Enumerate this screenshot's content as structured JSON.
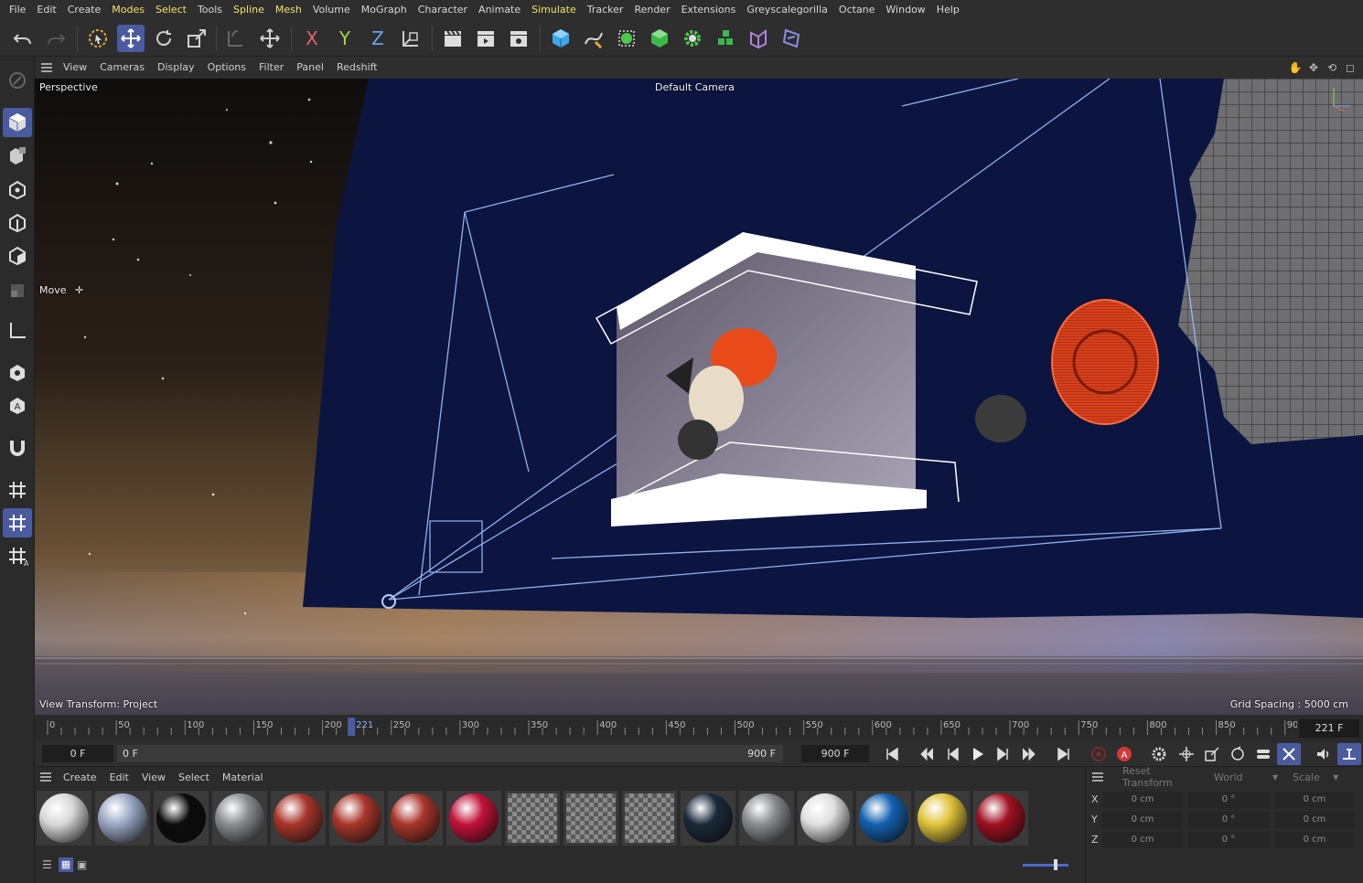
{
  "menu": {
    "items": [
      {
        "label": "File",
        "hl": false
      },
      {
        "label": "Edit",
        "hl": false
      },
      {
        "label": "Create",
        "hl": false
      },
      {
        "label": "Modes",
        "hl": true
      },
      {
        "label": "Select",
        "hl": true
      },
      {
        "label": "Tools",
        "hl": false
      },
      {
        "label": "Spline",
        "hl": true
      },
      {
        "label": "Mesh",
        "hl": true
      },
      {
        "label": "Volume",
        "hl": false
      },
      {
        "label": "MoGraph",
        "hl": false
      },
      {
        "label": "Character",
        "hl": false
      },
      {
        "label": "Animate",
        "hl": false
      },
      {
        "label": "Simulate",
        "hl": true
      },
      {
        "label": "Tracker",
        "hl": false
      },
      {
        "label": "Render",
        "hl": false
      },
      {
        "label": "Extensions",
        "hl": false
      },
      {
        "label": "Greyscalegorilla",
        "hl": false
      },
      {
        "label": "Octane",
        "hl": false
      },
      {
        "label": "Window",
        "hl": false
      },
      {
        "label": "Help",
        "hl": false
      }
    ]
  },
  "toolbar": {
    "axis_x": "X",
    "axis_y": "Y",
    "axis_z": "Z"
  },
  "viewport_menu": {
    "items": [
      "View",
      "Cameras",
      "Display",
      "Options",
      "Filter",
      "Panel",
      "Redshift"
    ]
  },
  "viewport": {
    "projection": "Perspective",
    "camera": "Default Camera",
    "tool": "Move",
    "view_transform": "View Transform: Project",
    "grid_spacing": "Grid Spacing : 5000 cm"
  },
  "timeline": {
    "ticks": [
      "0",
      "50",
      "100",
      "150",
      "200",
      "250",
      "300",
      "350",
      "400",
      "450",
      "500",
      "550",
      "600",
      "650",
      "700",
      "750",
      "800",
      "850",
      "90"
    ],
    "playhead_label": "221",
    "current_frame": "221 F"
  },
  "playback": {
    "start": "0 F",
    "range_start": "0 F",
    "range_end": "900 F",
    "end": "900 F"
  },
  "materials": {
    "menu": [
      "Create",
      "Edit",
      "View",
      "Select",
      "Material"
    ],
    "swatches": [
      {
        "icon": "white-sphere-icon",
        "color": "#d8d8d8"
      },
      {
        "icon": "chrome-sphere-icon",
        "color": "#9aa8c4"
      },
      {
        "icon": "black-sphere-icon",
        "color": "#0c0c0c"
      },
      {
        "icon": "rock-sphere-icon",
        "color": "#8a8c90"
      },
      {
        "icon": "copper-sphere-icon",
        "color": "#a8362a"
      },
      {
        "icon": "copper-sphere-icon",
        "color": "#a8362a"
      },
      {
        "icon": "copper-sphere-icon",
        "color": "#a8362a"
      },
      {
        "icon": "red-sphere-icon",
        "color": "#c3123a"
      },
      {
        "icon": "checker-icon",
        "color": "#777777"
      },
      {
        "icon": "checker-icon",
        "color": "#777777"
      },
      {
        "icon": "checker-icon",
        "color": "#777777"
      },
      {
        "icon": "grid-sphere-icon",
        "color": "#1a2a3a"
      },
      {
        "icon": "rock-sphere-icon",
        "color": "#8a8c90"
      },
      {
        "icon": "white-sphere-icon",
        "color": "#e0e0e0"
      },
      {
        "icon": "blue-sphere-icon",
        "color": "#1261b0"
      },
      {
        "icon": "yellow-sphere-icon",
        "color": "#e0c43a"
      },
      {
        "icon": "darkred-sphere-icon",
        "color": "#a01020"
      }
    ]
  },
  "coordinates": {
    "reset": "Reset Transform",
    "space": "World",
    "mode": "Scale",
    "rows": [
      {
        "axis": "X",
        "pos": "0 cm",
        "rot": "0 °",
        "scale": "0 cm"
      },
      {
        "axis": "Y",
        "pos": "0 cm",
        "rot": "0 °",
        "scale": "0 cm"
      },
      {
        "axis": "Z",
        "pos": "0 cm",
        "rot": "0 °",
        "scale": "0 cm"
      }
    ]
  },
  "colors": {
    "accent": "#4a5ba0",
    "highlight_menu": "#f1e26b",
    "scene_blue": "#0b1540",
    "record_red": "#d13a3a"
  }
}
